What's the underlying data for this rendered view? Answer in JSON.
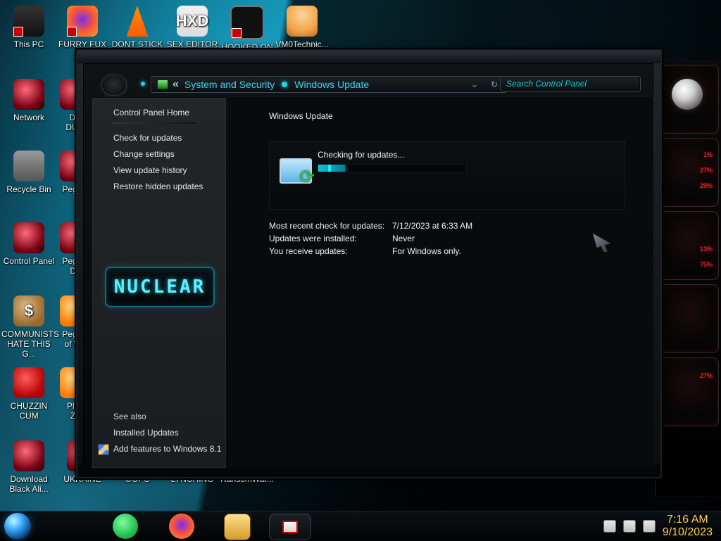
{
  "desktop": {
    "icons": [
      {
        "label": "This PC"
      },
      {
        "label": "FURRY FUX"
      },
      {
        "label": "DONT STICK"
      },
      {
        "label": "SEX EDITOR"
      },
      {
        "label": "HOOKED ON"
      },
      {
        "label": "VM0Technic..."
      },
      {
        "label": "Network"
      },
      {
        "label": "DU\nDUM"
      },
      {
        "label": "Recycle Bin"
      },
      {
        "label": "Peggle"
      },
      {
        "label": "Control Panel"
      },
      {
        "label": "Peggle\nDe"
      },
      {
        "label": "COMMUNISTS\nHATE THIS G..."
      },
      {
        "label": "Peggle\nof Wa"
      },
      {
        "label": "CHUZZIN\nCUM"
      },
      {
        "label": "Plan\nZo"
      },
      {
        "label": "Download\nBlack Ali..."
      },
      {
        "label": "UKRAINE"
      },
      {
        "label": "OOPS"
      },
      {
        "label": "LYNCHING"
      },
      {
        "label": "RansomWar..."
      }
    ]
  },
  "window": {
    "breadcrumb": {
      "back_glyph": "«",
      "items": [
        "System and Security",
        "Windows Update"
      ]
    },
    "search": {
      "placeholder": "Search Control Panel"
    },
    "left_pane": {
      "header": "Control Panel Home",
      "links": [
        "Check for updates",
        "Change settings",
        "View update history",
        "Restore hidden updates"
      ],
      "logo_text": "NUCLEAR",
      "see_also_label": "See also",
      "see_also_links": [
        "Installed Updates",
        "Add features to Windows 8.1"
      ]
    },
    "main": {
      "title": "Windows Update",
      "status": "Checking for updates...",
      "progress_fraction": 0.18,
      "details": [
        {
          "label": "Most recent check for updates:",
          "value": "7/12/2023 at 6:33 AM"
        },
        {
          "label": "Updates were installed:",
          "value": "Never"
        },
        {
          "label": "You receive updates:",
          "value": "For Windows only."
        }
      ]
    }
  },
  "right_widgets": {
    "percents": [
      "1%",
      "27%",
      "29%",
      "13%",
      "75%",
      "27%"
    ]
  },
  "taskbar": {
    "clock": {
      "time": "7:16 AM",
      "date": "9/10/2023"
    },
    "tray_icons": [
      "flag-warning-icon",
      "network-icon",
      "volume-icon"
    ]
  },
  "colors": {
    "accent": "#1dd4e6",
    "clock": "#ffd34a"
  }
}
